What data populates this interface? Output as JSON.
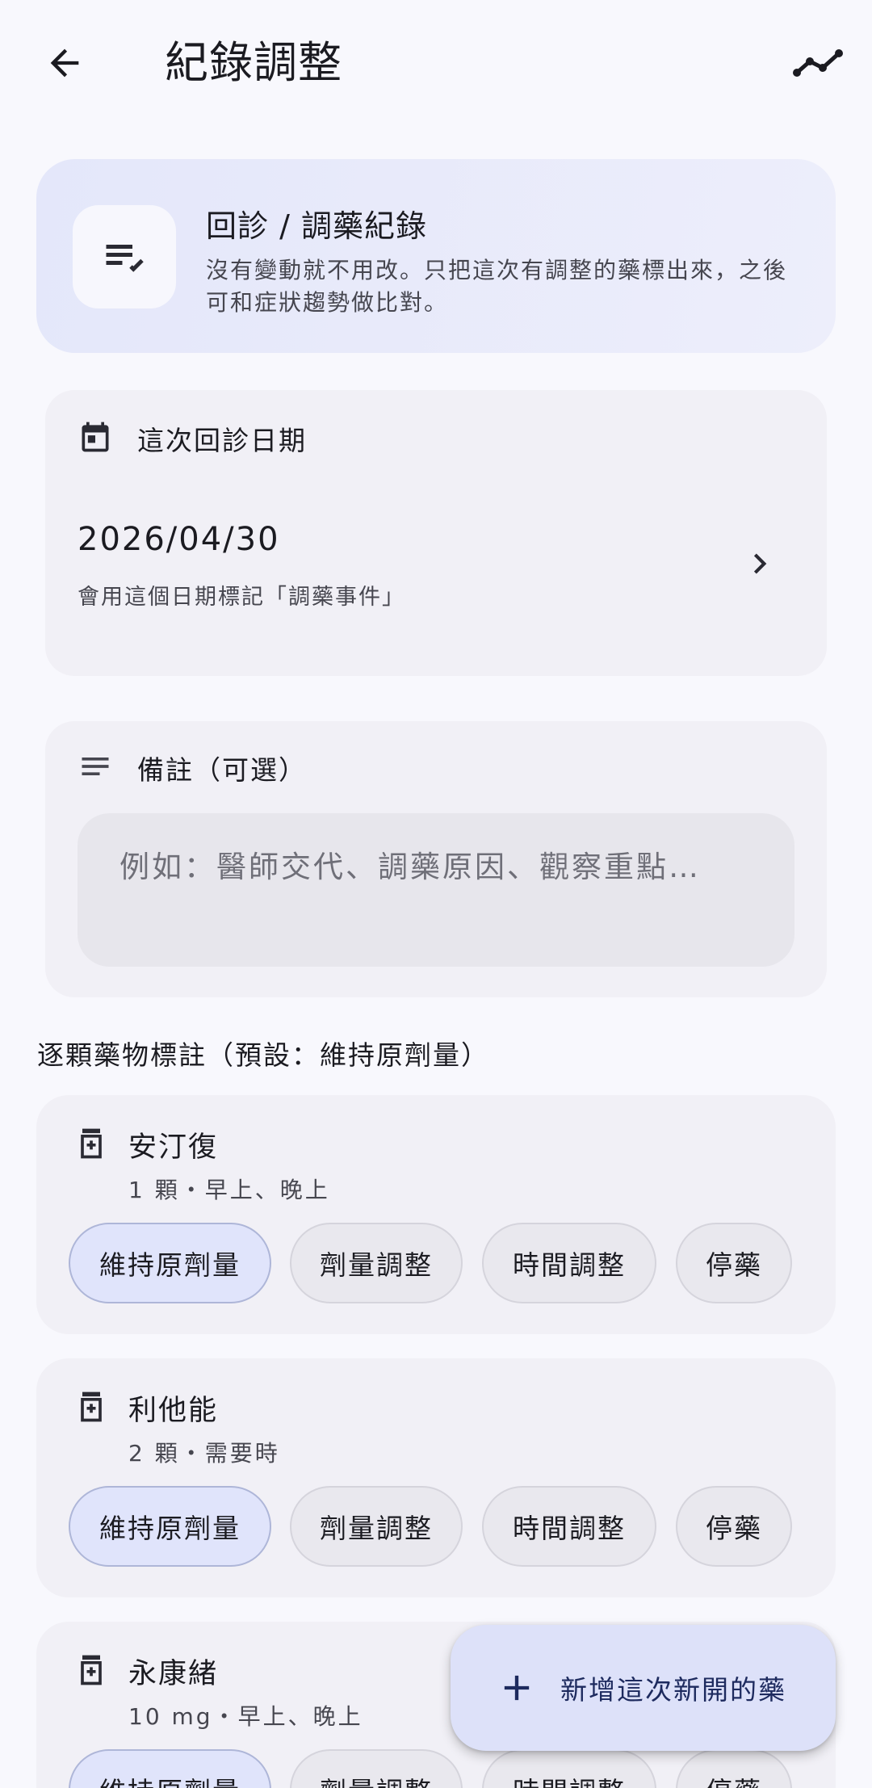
{
  "topbar": {
    "back_icon": "arrow-back-icon",
    "title": "紀錄調整",
    "trend_icon": "trend-line-icon"
  },
  "header": {
    "icon": "playlist-check-icon",
    "title": "回診 / 調藥紀錄",
    "subtitle": "沒有變動就不用改。只把這次有調整的藥標出來，之後可和症狀趨勢做比對。"
  },
  "visit_date": {
    "icon": "calendar-icon",
    "label": "這次回診日期",
    "value": "2026/04/30",
    "hint": "會用這個日期標記「調藥事件」",
    "chevron_icon": "chevron-right-icon"
  },
  "note": {
    "icon": "notes-icon",
    "label": "備註（可選）",
    "placeholder": "例如：醫師交代、調藥原因、觀察重點…"
  },
  "section_label": "逐顆藥物標註（預設：維持原劑量）",
  "chip_labels": [
    "維持原劑量",
    "劑量調整",
    "時間調整",
    "停藥"
  ],
  "medications": [
    {
      "name": "安汀復",
      "detail": "1 顆・早上、晚上",
      "selected": "維持原劑量"
    },
    {
      "name": "利他能",
      "detail": "2 顆・需要時",
      "selected": "維持原劑量"
    },
    {
      "name": "永康緒",
      "detail": "10 mg・早上、晚上",
      "selected": "維持原劑量"
    }
  ],
  "fab": {
    "icon": "plus-icon",
    "label": "新增這次新開的藥"
  },
  "colors": {
    "background": "#f8f8fd",
    "card": "#f1f0f6",
    "header_card": "#e4e7fa",
    "chip_selected": "#e0e4fb",
    "fab": "#dde1f9"
  }
}
